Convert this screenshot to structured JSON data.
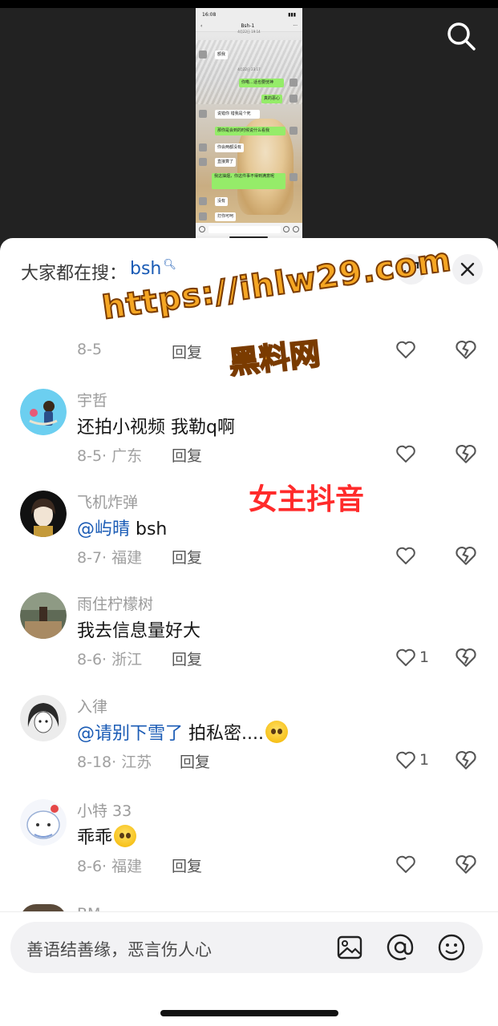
{
  "video": {
    "phone": {
      "status_time": "16:08",
      "chat_title": "Bsh-1",
      "date_1": "4月22日 19:14",
      "date_2": "4月22日 23:17",
      "messages": [
        {
          "side": "l",
          "text": "额我"
        },
        {
          "side": "r",
          "text": "你嘞…话也要恍神"
        },
        {
          "side": "r",
          "text": "真的恶心"
        },
        {
          "side": "l",
          "text": "说错你 错我是个死"
        },
        {
          "side": "r",
          "text": "那你是会到的时候说什么看我"
        },
        {
          "side": "l",
          "text": "你会两都没有"
        },
        {
          "side": "l",
          "text": "直接算了"
        },
        {
          "side": "r",
          "text": "我这抽烟，你这件事不得到满意呢"
        },
        {
          "side": "l",
          "text": "没有"
        },
        {
          "side": "l",
          "text": "打你可呵"
        }
      ]
    }
  },
  "sheet": {
    "trending_label": "大家都在搜：",
    "trending_term": "bsh"
  },
  "partial_comment": {
    "time": "8-5",
    "reply_label": "回复"
  },
  "comments": [
    {
      "user": "宇哲",
      "text": "还拍小视频 我勒q啊",
      "mention": "",
      "emoji": false,
      "date": "8-5",
      "region": "广东",
      "reply_label": "回复",
      "likes": ""
    },
    {
      "user": "飞机炸弹",
      "text": " bsh",
      "mention": "@屿晴",
      "emoji": false,
      "date": "8-7",
      "region": "福建",
      "reply_label": "回复",
      "likes": ""
    },
    {
      "user": "雨住柠檬树",
      "text": "我去信息量好大",
      "mention": "",
      "emoji": false,
      "date": "8-6",
      "region": "浙江",
      "reply_label": "回复",
      "likes": "1"
    },
    {
      "user": "入律",
      "text": " 拍私密....",
      "mention": "@请别下雪了",
      "emoji": true,
      "date": "8-18",
      "region": "江苏",
      "reply_label": "回复",
      "likes": "1"
    },
    {
      "user": "小特 33",
      "text": "乖乖",
      "mention": "",
      "emoji": true,
      "date": "8-6",
      "region": "福建",
      "reply_label": "回复",
      "likes": ""
    }
  ],
  "next_comment": {
    "user": "BM"
  },
  "watermark": {
    "url": "https://ihlw29.com",
    "name": "黑料网",
    "tag": "女主抖音"
  },
  "input": {
    "placeholder": "善语结善缘，恶言伤人心"
  },
  "colors": {
    "mention": "#1a5bb5",
    "watermark_orange": "#f5a623",
    "tag_red": "#ff2b2b"
  },
  "icons": [
    "search-icon",
    "expand-icon",
    "close-icon",
    "heart-icon",
    "broken-heart-icon",
    "image-icon",
    "at-icon",
    "emoji-icon"
  ]
}
